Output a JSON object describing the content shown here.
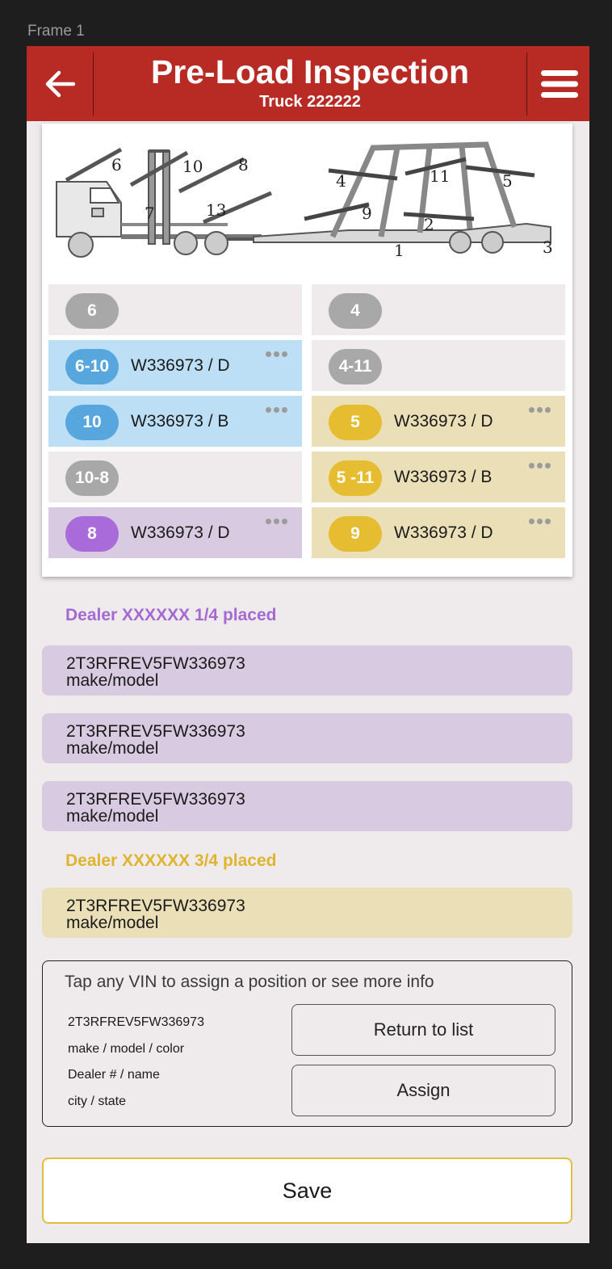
{
  "frame_label": "Frame 1",
  "header": {
    "title": "Pre-Load Inspection",
    "subtitle": "Truck 222222",
    "background": "#b82a24"
  },
  "diagram": {
    "numbers": [
      "6",
      "10",
      "8",
      "7",
      "13",
      "4",
      "11",
      "5",
      "9",
      "2",
      "1",
      "3"
    ]
  },
  "slots_left": [
    {
      "label": "6",
      "vin": "",
      "color": "#a8a8a8",
      "bg": "#efebec",
      "menu": false
    },
    {
      "label": "6-10",
      "vin": "W336973 / D",
      "color": "#57a6dd",
      "bg": "#bcdff6",
      "menu": true
    },
    {
      "label": "10",
      "vin": "W336973 / B",
      "color": "#57a6dd",
      "bg": "#bcdff6",
      "menu": true
    },
    {
      "label": "10-8",
      "vin": "",
      "color": "#a8a8a8",
      "bg": "#efebec",
      "menu": false
    },
    {
      "label": "8",
      "vin": "W336973 / D",
      "color": "#a96bd9",
      "bg": "#d8cae0",
      "menu": true
    }
  ],
  "slots_right": [
    {
      "label": "4",
      "vin": "",
      "color": "#a8a8a8",
      "bg": "#efebec",
      "menu": false
    },
    {
      "label": "4-11",
      "vin": "",
      "color": "#a8a8a8",
      "bg": "#efebec",
      "menu": false
    },
    {
      "label": "5",
      "vin": "W336973 / D",
      "color": "#e6bd30",
      "bg": "#ebdfb7",
      "menu": true
    },
    {
      "label": "5 -11",
      "vin": "W336973 / B",
      "color": "#e6bd30",
      "bg": "#ebdfb7",
      "menu": true
    },
    {
      "label": "9",
      "vin": "W336973 / D",
      "color": "#e6bd30",
      "bg": "#ebdfb7",
      "menu": true
    }
  ],
  "dealer_groups": [
    {
      "heading": "Dealer XXXXXX  1/4 placed",
      "color": "#a56ad1",
      "row_bg": "#d8cae0",
      "vehicles": [
        {
          "vin": "2T3RFREV5FW336973",
          "desc": "make/model"
        },
        {
          "vin": "2T3RFREV5FW336973",
          "desc": "make/model"
        },
        {
          "vin": "2T3RFREV5FW336973",
          "desc": "make/model"
        }
      ]
    },
    {
      "heading": "Dealer XXXXXX  3/4 placed",
      "color": "#dfb42f",
      "row_bg": "#ebdfb7",
      "vehicles": [
        {
          "vin": "2T3RFREV5FW336973",
          "desc": "make/model"
        }
      ]
    }
  ],
  "info_panel": {
    "hint": "Tap any VIN to assign a position or see more info",
    "vin": "2T3RFREV5FW336973",
    "make_model": "make / model / color",
    "dealer": "Dealer # / name",
    "location": "city /  state",
    "return_label": "Return to list",
    "assign_label": "Assign"
  },
  "save_label": "Save",
  "icons": {
    "back": "arrow-left-icon",
    "menu": "hamburger-menu-icon",
    "more": "more-dots-icon"
  }
}
